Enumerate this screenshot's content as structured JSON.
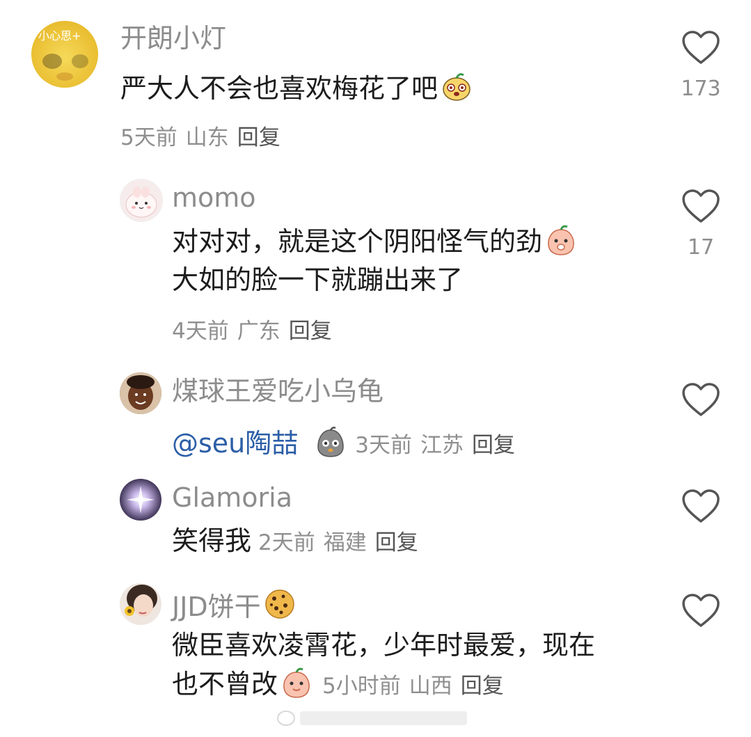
{
  "comments": [
    {
      "username": "开朗小灯",
      "avatar_text": "小心思+",
      "text": "严大人不会也喜欢梅花了吧",
      "time": "5天前",
      "location": "山东",
      "reply_label": "回复",
      "likes": "173"
    },
    {
      "username": "momo",
      "text_line1": "对对对，就是这个阴阳怪气的劲",
      "text_line2": "大如的脸一下就蹦出来了",
      "time": "4天前",
      "location": "广东",
      "reply_label": "回复",
      "likes": "17"
    },
    {
      "username": "煤球王爱吃小乌龟",
      "mention": "@seu陶喆",
      "time": "3天前",
      "location": "江苏",
      "reply_label": "回复"
    },
    {
      "username": "Glamoria",
      "text": "笑得我",
      "time": "2天前",
      "location": "福建",
      "reply_label": "回复"
    },
    {
      "username": "JJD饼干",
      "text_line1": "微臣喜欢凌霄花，少年时最爱，现在",
      "text_line2": "也不曾改",
      "time": "5小时前",
      "location": "山西",
      "reply_label": "回复"
    }
  ],
  "colors": {
    "username": "#8c8c8c",
    "text": "#1c1c1c",
    "meta": "#8f8f8f",
    "mention": "#2b5ea7",
    "heart_outline": "#555555"
  },
  "icons": [
    "heart-outline-icon",
    "emoji-face-icon",
    "cookie-icon"
  ]
}
